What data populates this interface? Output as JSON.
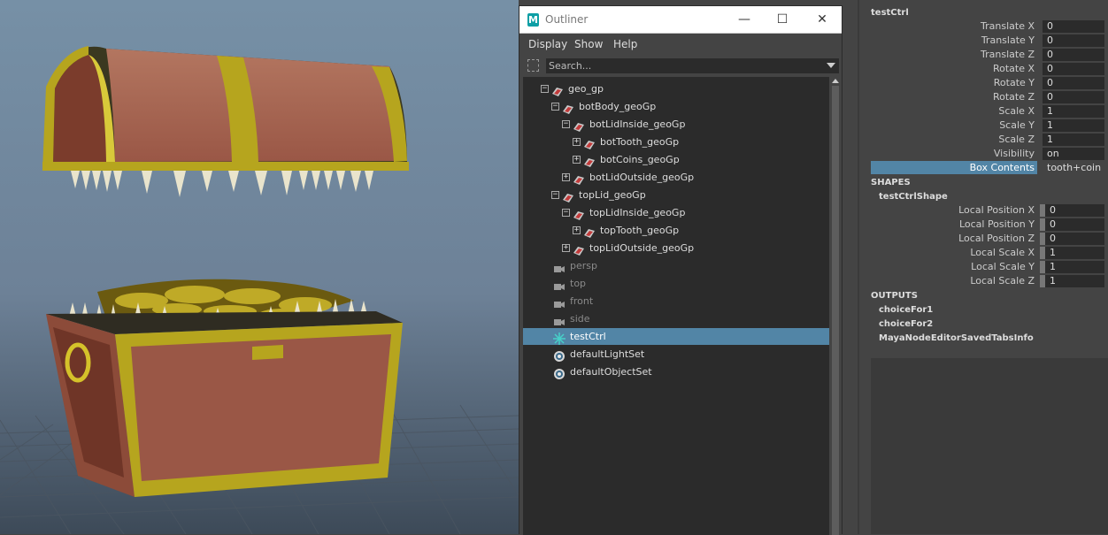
{
  "outliner": {
    "title": "Outliner",
    "window_buttons": [
      "—",
      "☐",
      "✕"
    ],
    "menus": [
      "Display",
      "Show",
      "Help"
    ],
    "search_placeholder": "Search...",
    "items": [
      {
        "label": "geo_gp",
        "icon": "group-icon",
        "expander": "−"
      },
      {
        "label": "botBody_geoGp",
        "icon": "group-icon",
        "expander": "−"
      },
      {
        "label": "botLidInside_geoGp",
        "icon": "group-icon",
        "expander": "−"
      },
      {
        "label": "botTooth_geoGp",
        "icon": "group-icon",
        "expander": "+"
      },
      {
        "label": "botCoins_geoGp",
        "icon": "group-icon",
        "expander": "+"
      },
      {
        "label": "botLidOutside_geoGp",
        "icon": "group-icon",
        "expander": "+"
      },
      {
        "label": "topLid_geoGp",
        "icon": "group-icon",
        "expander": "−"
      },
      {
        "label": "topLidInside_geoGp",
        "icon": "group-icon",
        "expander": "−"
      },
      {
        "label": "topTooth_geoGp",
        "icon": "group-icon",
        "expander": "+"
      },
      {
        "label": "topLidOutside_geoGp",
        "icon": "group-icon",
        "expander": "+"
      },
      {
        "label": "persp",
        "icon": "camera-icon",
        "dim": true
      },
      {
        "label": "top",
        "icon": "camera-icon",
        "dim": true
      },
      {
        "label": "front",
        "icon": "camera-icon",
        "dim": true
      },
      {
        "label": "side",
        "icon": "camera-icon",
        "dim": true
      },
      {
        "label": "testCtrl",
        "icon": "control-icon",
        "selected": true
      },
      {
        "label": "defaultLightSet",
        "icon": "set-icon"
      },
      {
        "label": "defaultObjectSet",
        "icon": "set-icon"
      }
    ]
  },
  "attributes": {
    "node_name": "testCtrl",
    "transform_attrs": [
      {
        "label": "Translate X",
        "value": "0"
      },
      {
        "label": "Translate Y",
        "value": "0"
      },
      {
        "label": "Translate Z",
        "value": "0"
      },
      {
        "label": "Rotate X",
        "value": "0"
      },
      {
        "label": "Rotate Y",
        "value": "0"
      },
      {
        "label": "Rotate Z",
        "value": "0"
      },
      {
        "label": "Scale X",
        "value": "1"
      },
      {
        "label": "Scale Y",
        "value": "1"
      },
      {
        "label": "Scale Z",
        "value": "1"
      },
      {
        "label": "Visibility",
        "value": "on"
      },
      {
        "label": "Box Contents",
        "value": "tooth+coin",
        "highlighted": true
      }
    ],
    "shapes_header": "SHAPES",
    "shape_name": "testCtrlShape",
    "shape_attrs": [
      {
        "label": "Local Position X",
        "value": "0"
      },
      {
        "label": "Local Position Y",
        "value": "0"
      },
      {
        "label": "Local Position Z",
        "value": "0"
      },
      {
        "label": "Local Scale X",
        "value": "1"
      },
      {
        "label": "Local Scale Y",
        "value": "1"
      },
      {
        "label": "Local Scale Z",
        "value": "1"
      }
    ],
    "outputs_header": "OUTPUTS",
    "outputs": [
      "choiceFor1",
      "choiceFor2",
      "MayaNodeEditorSavedTabsInfo"
    ]
  },
  "colors": {
    "selection": "#5285a6",
    "panel_bg": "#444444",
    "field_bg": "#2b2b2b",
    "chest_wood": "#9a5746",
    "chest_gold": "#b6a51e",
    "viewport_sky": "#7d93a8"
  }
}
